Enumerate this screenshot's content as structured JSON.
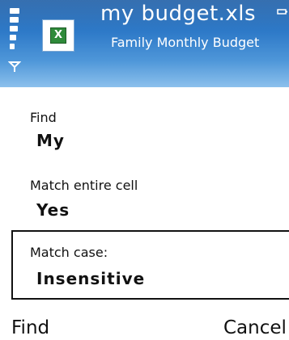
{
  "header": {
    "title": "my budget.xls",
    "subtitle": "Family Monthly Budget",
    "app_icon": "excel-file-icon",
    "app_icon_glyph": "X",
    "signal_icon": "signal-strength-icon",
    "antenna_icon": "antenna-icon",
    "battery_icon": "battery-icon"
  },
  "form": {
    "find": {
      "label": "Find",
      "value": "My"
    },
    "match_entire_cell": {
      "label": "Match entire cell",
      "value": "Yes"
    },
    "match_case": {
      "label": "Match case:",
      "value": "Insensitive"
    }
  },
  "softkeys": {
    "left": "Find",
    "right": "Cancel"
  },
  "colors": {
    "header_top": "#1f5fa7",
    "header_bottom": "#8cc0ec",
    "text": "#111111",
    "background": "#ffffff"
  }
}
